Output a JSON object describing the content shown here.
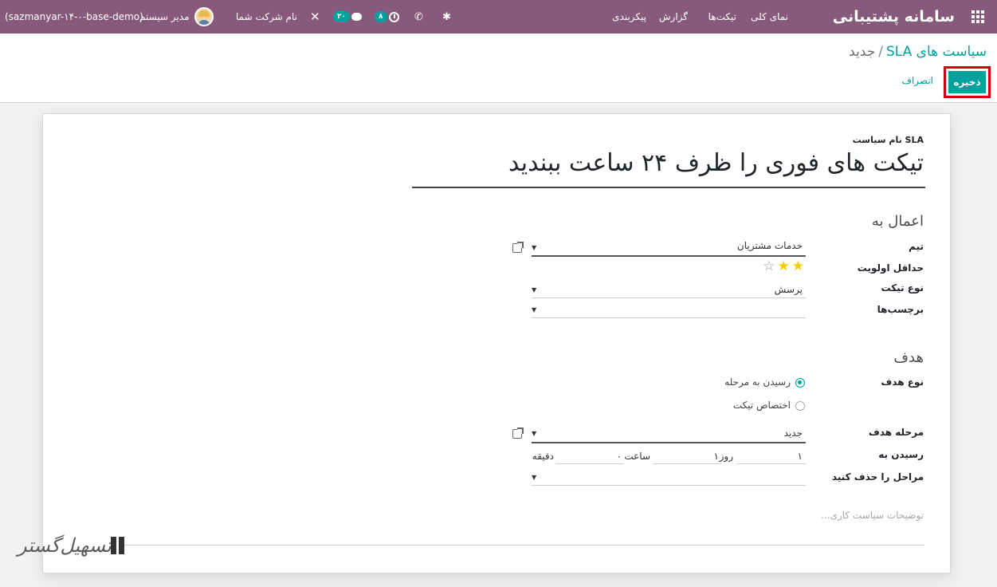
{
  "navbar": {
    "app_title": "سامانه پشتیبانی",
    "menu": {
      "overview": "نمای کلی",
      "tickets": "تیکت‌ها",
      "reporting": "گزارش",
      "configuration": "پیکربندی"
    },
    "chat_count": "۲۰",
    "activity_count": "۸",
    "company": "نام شرکت شما",
    "user": "مدیر سیستم",
    "database": "(sazmanyar-۱۴-۰-base-demo)"
  },
  "breadcrumb": {
    "parent": "سیاست های SLA",
    "separator": "/",
    "current": "جدید"
  },
  "buttons": {
    "save": "ذخیره",
    "discard": "انصراف"
  },
  "form": {
    "name_label": "نام سیاست SLA",
    "name_value": "تیکت های فوری را ظرف ۲۴ ساعت ببندید",
    "apply_on": {
      "title": "اعمال به",
      "team_label": "تیم",
      "team_value": "خدمات مشتریان",
      "min_priority_label": "حداقل اولویت",
      "priority_stars": 2,
      "priority_max": 3,
      "ticket_type_label": "نوع تیکت",
      "ticket_type_value": "پرسش",
      "tags_label": "برچسب‌ها",
      "tags_value": ""
    },
    "target": {
      "title": "هدف",
      "target_type_label": "نوع هدف",
      "option_reach_stage": "رسیدن به مرحله",
      "option_assign": "اختصاص تیکت",
      "selected_option": "reach_stage",
      "target_stage_label": "مرحله هدف",
      "target_stage_value": "جدید",
      "reach_in_label": "رسیدن به",
      "days_value": "۱",
      "days_unit": "روز",
      "hours_value": "۱",
      "hours_unit": "ساعت",
      "minutes_value": "۰",
      "minutes_unit": "دقیقه",
      "exclude_stages_label": "مراحل را حذف کنید",
      "exclude_stages_value": ""
    },
    "description_placeholder": "توضیحات سیاست کاری..."
  },
  "watermark": {
    "text": "تسهیل‌گستر"
  },
  "colors": {
    "navbar": "#875a7b",
    "accent": "#00a09d",
    "highlight_border": "#d00010",
    "star": "#f3cc00"
  }
}
